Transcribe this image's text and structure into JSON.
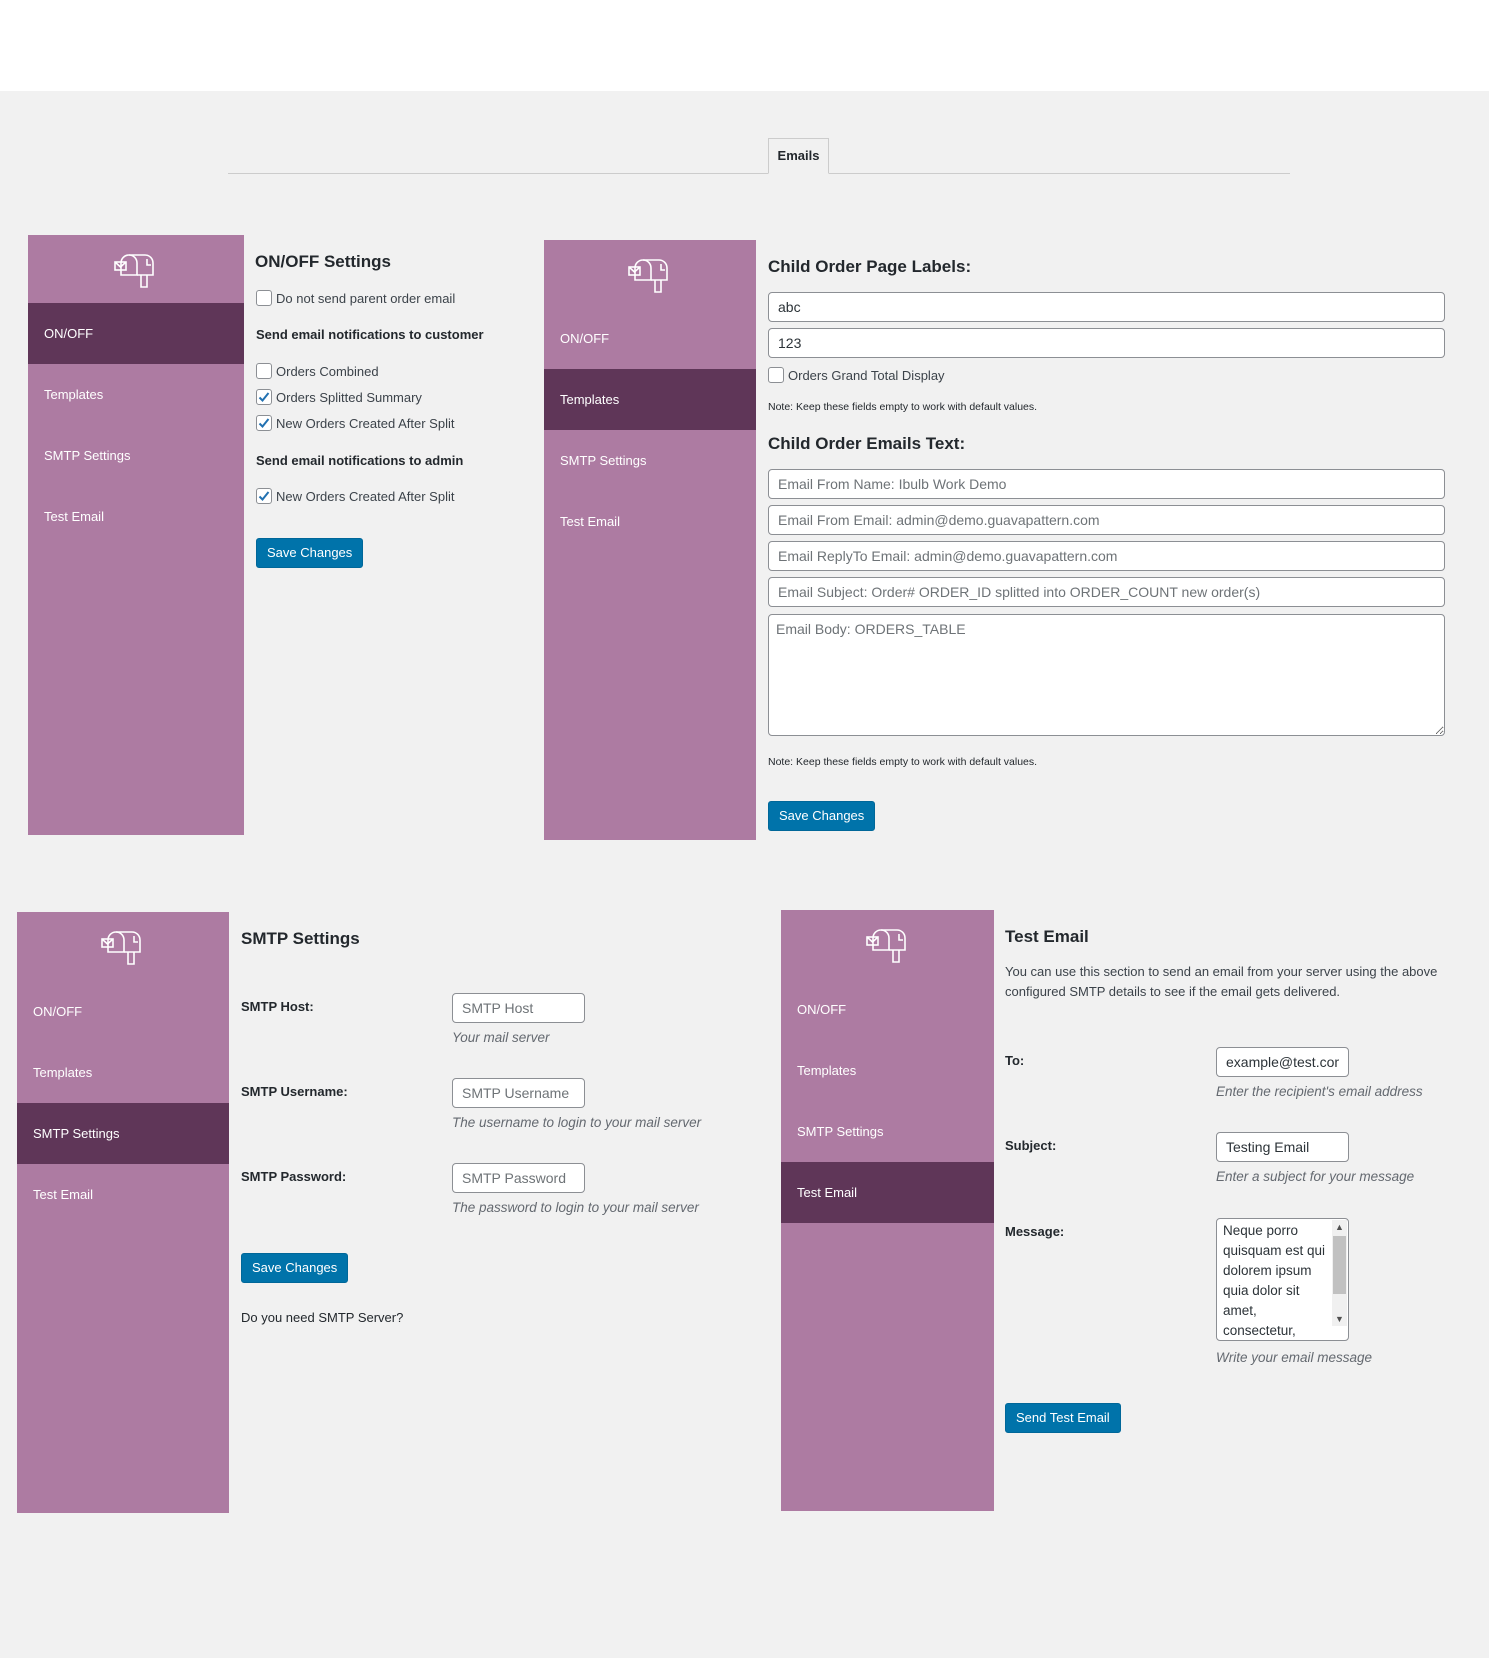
{
  "tabs": {
    "emails": "Emails"
  },
  "nav": {
    "onoff": "ON/OFF",
    "templates": "Templates",
    "smtp": "SMTP Settings",
    "test": "Test Email"
  },
  "icons": {
    "logo": "mailbox-icon",
    "check": "checkmark-icon"
  },
  "colors": {
    "sidebar": "#ad7ba2",
    "sidebar_active": "#5f3658",
    "button": "#0073aa"
  },
  "onoff_panel": {
    "title": "ON/OFF Settings",
    "parent_email": "Do not send parent order email",
    "customer_heading": "Send email notifications to customer",
    "orders_combined": "Orders Combined",
    "orders_splitted_summary": "Orders Splitted Summary",
    "new_orders_customer": "New Orders Created After Split",
    "admin_heading": "Send email notifications to admin",
    "new_orders_admin": "New Orders Created After Split",
    "save": "Save Changes",
    "checks": {
      "parent_email": false,
      "orders_combined": false,
      "orders_splitted_summary": true,
      "new_orders_customer": true,
      "new_orders_admin": true
    }
  },
  "templates_panel": {
    "labels_title": "Child Order Page Labels:",
    "label1_value": "abc",
    "label2_value": "123",
    "grand_total": "Orders Grand Total Display",
    "note1": "Note: Keep these fields empty to work with default values.",
    "emails_title": "Child Order Emails Text:",
    "from_name_placeholder": "Email From Name: Ibulb Work Demo",
    "from_email_placeholder": "Email From Email: admin@demo.guavapattern.com",
    "replyto_placeholder": "Email ReplyTo Email: admin@demo.guavapattern.com",
    "subject_placeholder": "Email Subject: Order# ORDER_ID splitted into ORDER_COUNT new order(s)",
    "body_placeholder": "Email Body: ORDERS_TABLE",
    "note2": "Note: Keep these fields empty to work with default values.",
    "save": "Save Changes"
  },
  "smtp_panel": {
    "title": "SMTP Settings",
    "host_label": "SMTP Host:",
    "host_placeholder": "SMTP Host",
    "host_desc": "Your mail server",
    "username_label": "SMTP Username:",
    "username_placeholder": "SMTP Username",
    "username_desc": "The username to login to your mail server",
    "password_label": "SMTP Password:",
    "password_placeholder": "SMTP Password",
    "password_desc": "The password to login to your mail server",
    "save": "Save Changes",
    "need_server": "Do you need SMTP Server?"
  },
  "test_panel": {
    "title": "Test Email",
    "intro": "You can use this section to send an email from your server using the above configured SMTP details to see if the email gets delivered.",
    "to_label": "To:",
    "to_value": "example@test.com",
    "to_desc": "Enter the recipient's email address",
    "subject_label": "Subject:",
    "subject_value": "Testing Email",
    "subject_desc": "Enter a subject for your message",
    "message_label": "Message:",
    "message_value": "Neque porro quisquam est qui dolorem ipsum quia dolor sit amet, consectetur,",
    "message_desc": "Write your email message",
    "send": "Send Test Email"
  }
}
